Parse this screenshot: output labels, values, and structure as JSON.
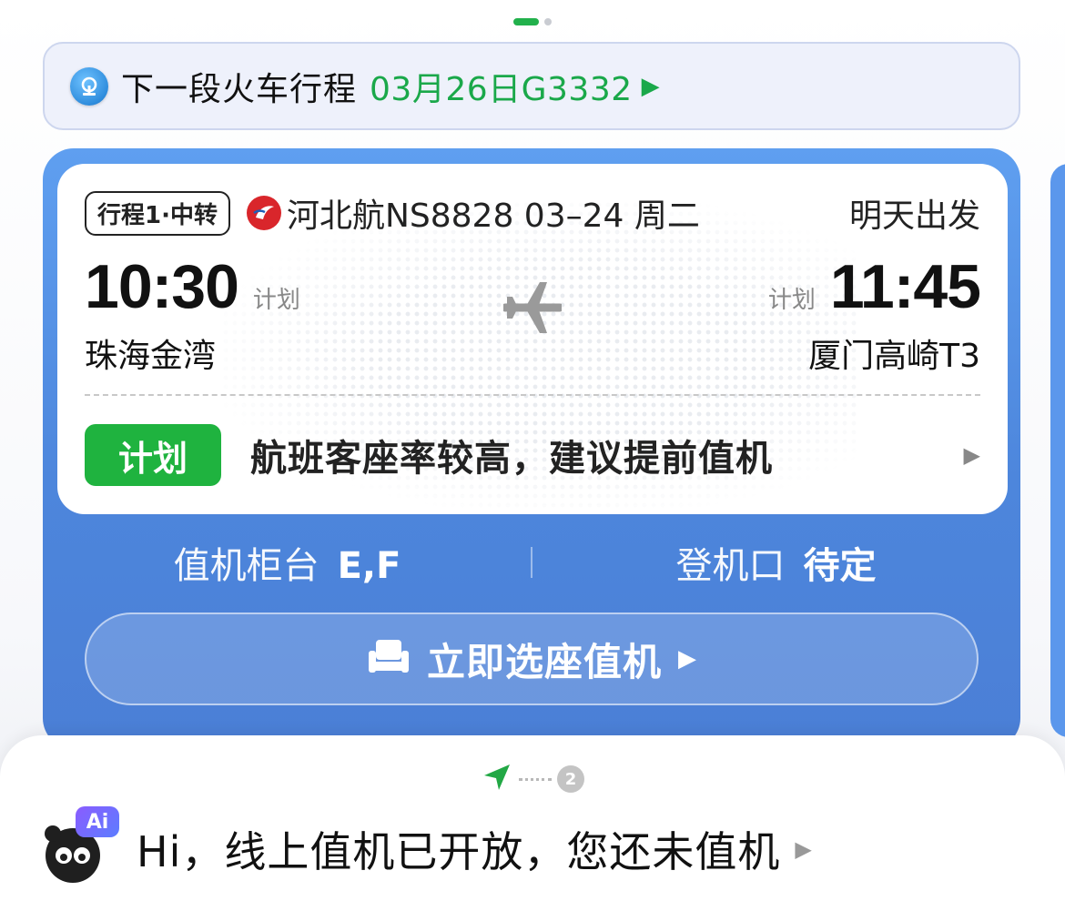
{
  "pager": {
    "count": 2,
    "active": 0
  },
  "train_banner": {
    "label": "下一段火车行程",
    "trip": "03月26日G3332",
    "arrow": "▶",
    "icon": "railway-icon"
  },
  "flight": {
    "trip_tag": "行程1·中转",
    "airline_icon": "hebei-airlines-logo",
    "airline_info": "河北航NS8828 03–24 周二",
    "depart_status": "明天出发",
    "departure": {
      "time": "10:30",
      "status": "计划",
      "airport": "珠海金湾"
    },
    "arrival": {
      "time": "11:45",
      "status": "计划",
      "airport": "厦门高崎T3"
    },
    "notice": {
      "badge": "计划",
      "text": "航班客座率较高，建议提前值机",
      "arrow": "▶"
    },
    "counter": {
      "label": "值机柜台",
      "value": "E,F"
    },
    "gate": {
      "label": "登机口",
      "value": "待定"
    },
    "checkin_button": {
      "label": "立即选座值机",
      "arrow": "▶",
      "icon": "seat-icon"
    }
  },
  "assistant": {
    "step_number": "2",
    "badge": "Ai",
    "greeting": "Hi，线上值机已开放，您还未值机",
    "arrow": "▶"
  },
  "colors": {
    "accent_green": "#1aa84a",
    "card_blue": "#4d86dc",
    "badge_green": "#1fb33f"
  }
}
